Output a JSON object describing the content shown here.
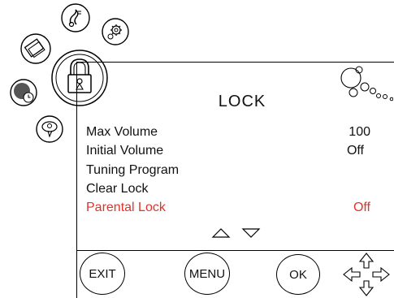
{
  "screen": {
    "title": "LOCK",
    "items": [
      {
        "label": "Max Volume",
        "value": "100",
        "selected": false
      },
      {
        "label": "Initial Volume",
        "value": "Off",
        "selected": false
      },
      {
        "label": "Tuning Program",
        "value": "",
        "selected": false
      },
      {
        "label": "Clear Lock",
        "value": "",
        "selected": false
      },
      {
        "label": "Parental Lock",
        "value": "Off",
        "selected": true
      }
    ]
  },
  "bottom_buttons": {
    "exit": "EXIT",
    "menu": "MENU",
    "ok": "OK"
  },
  "icons": {
    "side_menu": [
      "display-icon",
      "music-icon",
      "gear-icon",
      "lock-icon",
      "clock-icon",
      "chat-icon"
    ],
    "decor": "bubbles-icon",
    "nav": "arrow-pad-icon"
  },
  "colors": {
    "selected": "#e0342b",
    "text": "#111111"
  }
}
